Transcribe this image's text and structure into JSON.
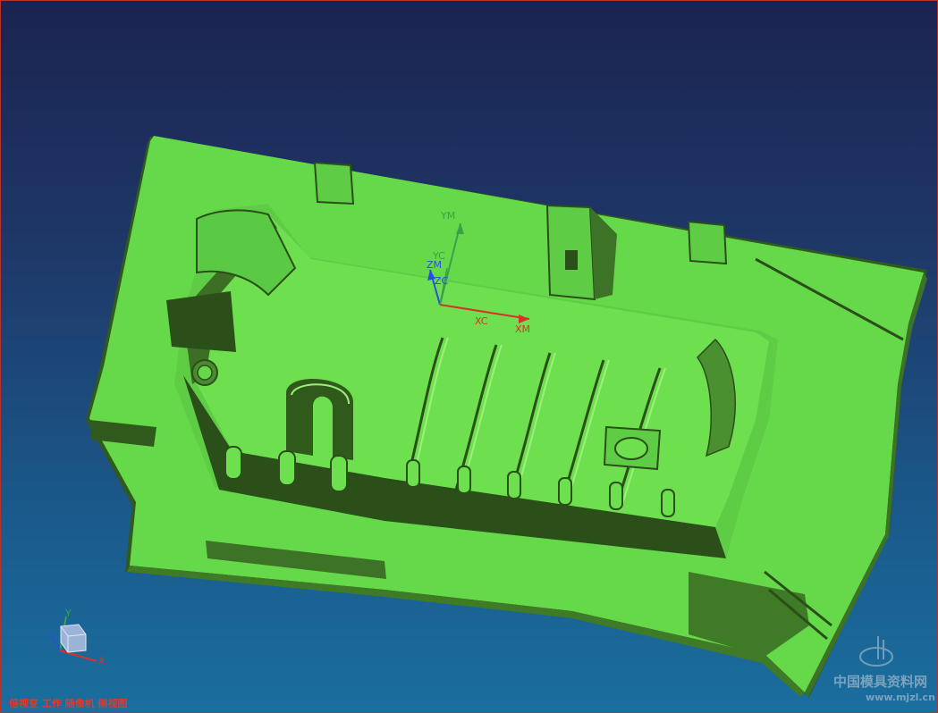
{
  "viewport": {
    "background_top": "#1b2350",
    "background_bottom": "#1a6e9e",
    "model_color": "#66d94b",
    "model_shadow_color": "#2f5a1c"
  },
  "work_csys": {
    "ym": "YM",
    "yc": "YC",
    "zm": "ZM",
    "zc": "ZC",
    "xc": "XC",
    "xm": "XM"
  },
  "view_triad": {
    "x": "X",
    "y": "Y"
  },
  "status_text": "倍视变 工作 随像机 侧视图",
  "watermark": {
    "text": "中国模具资料网",
    "url": "www.mjzl.cn"
  }
}
